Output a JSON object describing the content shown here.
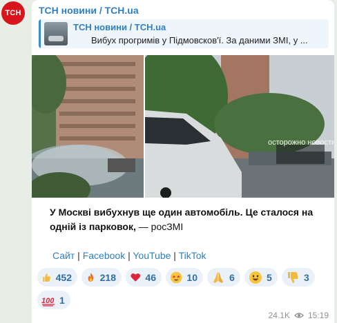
{
  "channel": {
    "avatar_text": "ТСН",
    "name": "ТСН новини / TCH.ua"
  },
  "reply": {
    "title": "ТСН новини / TCH.ua",
    "text": "Вибух прогримів у Підмовсков'ї. За даними ЗМІ, у ..."
  },
  "photos": {
    "watermark": "осторожно новости"
  },
  "caption": {
    "bold": "У Москві вибухнув ще один автомобіль. Це сталося на одній із парковок,",
    "plain": " — росЗМІ"
  },
  "links": {
    "site": "Сайт",
    "sep": " | ",
    "facebook": "Facebook",
    "youtube": "YouTube",
    "tiktok": "TikTok"
  },
  "reactions": [
    {
      "icon": "thumbs-up",
      "count": "452"
    },
    {
      "icon": "fire",
      "count": "218"
    },
    {
      "icon": "red-heart",
      "count": "46"
    },
    {
      "icon": "starstruck-face",
      "count": "10"
    },
    {
      "icon": "praying-hands",
      "count": "6"
    },
    {
      "icon": "grinning-face",
      "count": "5"
    },
    {
      "icon": "thumbs-down",
      "count": "3"
    },
    {
      "icon": "hundred-points",
      "count": "1"
    }
  ],
  "meta": {
    "views": "24.1K",
    "time": "15:19"
  },
  "colors": {
    "accent": "#2f7fc1",
    "avatar": "#d8141c",
    "reaction_bg": "#eaf1f8"
  }
}
